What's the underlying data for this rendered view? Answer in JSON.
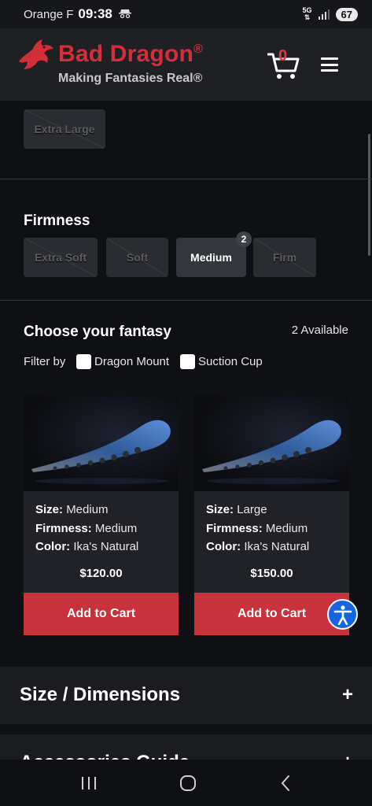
{
  "status_bar": {
    "carrier": "Orange F",
    "time": "09:38",
    "network": "5G",
    "battery": "67"
  },
  "header": {
    "brand": "Bad Dragon",
    "registered": "®",
    "tagline": "Making Fantasies Real®",
    "cart_count": "0"
  },
  "size": {
    "options": [
      {
        "label": "Extra Large",
        "state": "disabled"
      }
    ]
  },
  "firmness": {
    "title": "Firmness",
    "options": [
      {
        "label": "Extra Soft",
        "state": "disabled"
      },
      {
        "label": "Soft",
        "state": "disabled"
      },
      {
        "label": "Medium",
        "state": "selected",
        "count": "2"
      },
      {
        "label": "Firm",
        "state": "disabled"
      }
    ]
  },
  "fantasy": {
    "title": "Choose your fantasy",
    "available": "2 Available",
    "filter_label": "Filter by",
    "filters": [
      {
        "label": "Dragon Mount",
        "checked": false
      },
      {
        "label": "Suction Cup",
        "checked": false
      }
    ]
  },
  "products": [
    {
      "size_label": "Size:",
      "size": "Medium",
      "firmness_label": "Firmness:",
      "firmness": "Medium",
      "color_label": "Color:",
      "color": "Ika's Natural",
      "price": "$120.00",
      "button": "Add to Cart"
    },
    {
      "size_label": "Size:",
      "size": "Large",
      "firmness_label": "Firmness:",
      "firmness": "Medium",
      "color_label": "Color:",
      "color": "Ika's Natural",
      "price": "$150.00",
      "button": "Add to Cart"
    }
  ],
  "accordions": [
    {
      "title": "Size / Dimensions",
      "icon": "+"
    },
    {
      "title": "Accessories Guide",
      "icon": "+"
    }
  ],
  "colors": {
    "brand_red": "#d32f3a",
    "button_red": "#c8323d",
    "accessibility_blue": "#1565e0"
  }
}
